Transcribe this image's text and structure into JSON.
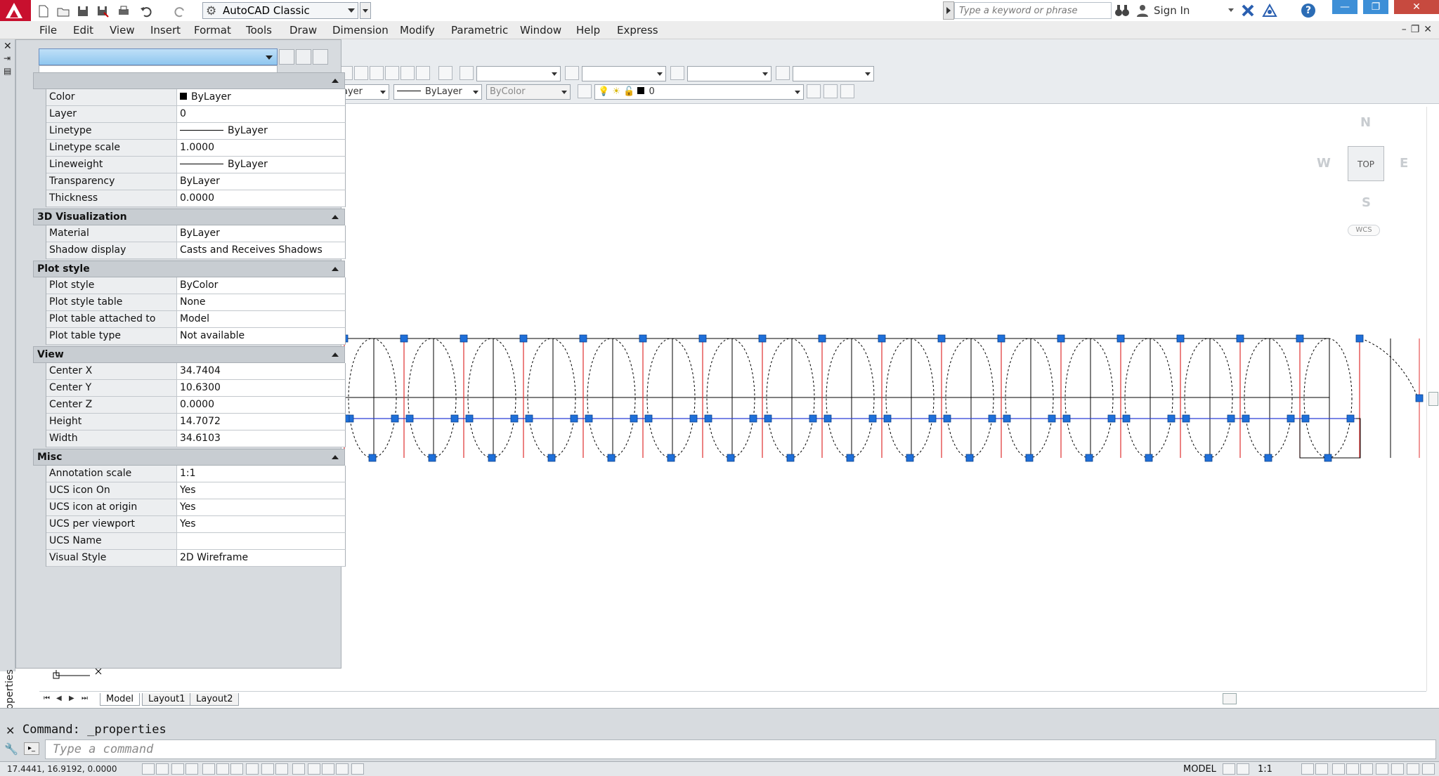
{
  "app": {
    "workspace": "AutoCAD Classic",
    "search_placeholder": "Type a keyword or phrase",
    "signin_label": "Sign In",
    "help_label": "?"
  },
  "menu": [
    "File",
    "Edit",
    "View",
    "Insert",
    "Format",
    "Tools",
    "Draw",
    "Dimension",
    "Modify",
    "Parametric",
    "Window",
    "Help",
    "Express"
  ],
  "toolbars": {
    "layer_partial": "ayer",
    "linetype": "ByLayer",
    "plotstyle": "ByColor",
    "layer_current": "0"
  },
  "properties": {
    "palette_title": "Properties",
    "sections": [
      {
        "title": "",
        "rows": [
          {
            "name": "Color",
            "value": "ByLayer",
            "kind": "swatch"
          },
          {
            "name": "Layer",
            "value": "0"
          },
          {
            "name": "Linetype",
            "value": "ByLayer",
            "kind": "line"
          },
          {
            "name": "Linetype scale",
            "value": "1.0000"
          },
          {
            "name": "Lineweight",
            "value": "ByLayer",
            "kind": "line"
          },
          {
            "name": "Transparency",
            "value": "ByLayer"
          },
          {
            "name": "Thickness",
            "value": "0.0000"
          }
        ]
      },
      {
        "title": "3D Visualization",
        "rows": [
          {
            "name": "Material",
            "value": "ByLayer"
          },
          {
            "name": "Shadow display",
            "value": "Casts and Receives Shadows"
          }
        ]
      },
      {
        "title": "Plot style",
        "rows": [
          {
            "name": "Plot style",
            "value": "ByColor"
          },
          {
            "name": "Plot style table",
            "value": "None"
          },
          {
            "name": "Plot table attached to",
            "value": "Model"
          },
          {
            "name": "Plot table type",
            "value": "Not available"
          }
        ]
      },
      {
        "title": "View",
        "rows": [
          {
            "name": "Center X",
            "value": "34.7404"
          },
          {
            "name": "Center Y",
            "value": "10.6300"
          },
          {
            "name": "Center Z",
            "value": "0.0000"
          },
          {
            "name": "Height",
            "value": "14.7072"
          },
          {
            "name": "Width",
            "value": "34.6103"
          }
        ]
      },
      {
        "title": "Misc",
        "rows": [
          {
            "name": "Annotation scale",
            "value": "1:1"
          },
          {
            "name": "UCS icon On",
            "value": "Yes"
          },
          {
            "name": "UCS icon at origin",
            "value": "Yes"
          },
          {
            "name": "UCS per viewport",
            "value": "Yes"
          },
          {
            "name": "UCS Name",
            "value": ""
          },
          {
            "name": "Visual Style",
            "value": "2D Wireframe"
          }
        ]
      }
    ]
  },
  "viewcube": {
    "top": "TOP",
    "n": "N",
    "s": "S",
    "e": "E",
    "w": "W",
    "wcs": "WCS"
  },
  "tabs": [
    "Model",
    "Layout1",
    "Layout2"
  ],
  "command": {
    "history": "Command: _properties",
    "placeholder": "Type a command"
  },
  "status": {
    "coords": "17.4441, 16.9192, 0.0000",
    "model": "MODEL",
    "scale": "1:1"
  },
  "colors": {
    "grip": "#1e6fd9",
    "red_line": "#e03030",
    "blue_line": "#2a3fd6",
    "title_accent": "#3d8fd7"
  }
}
